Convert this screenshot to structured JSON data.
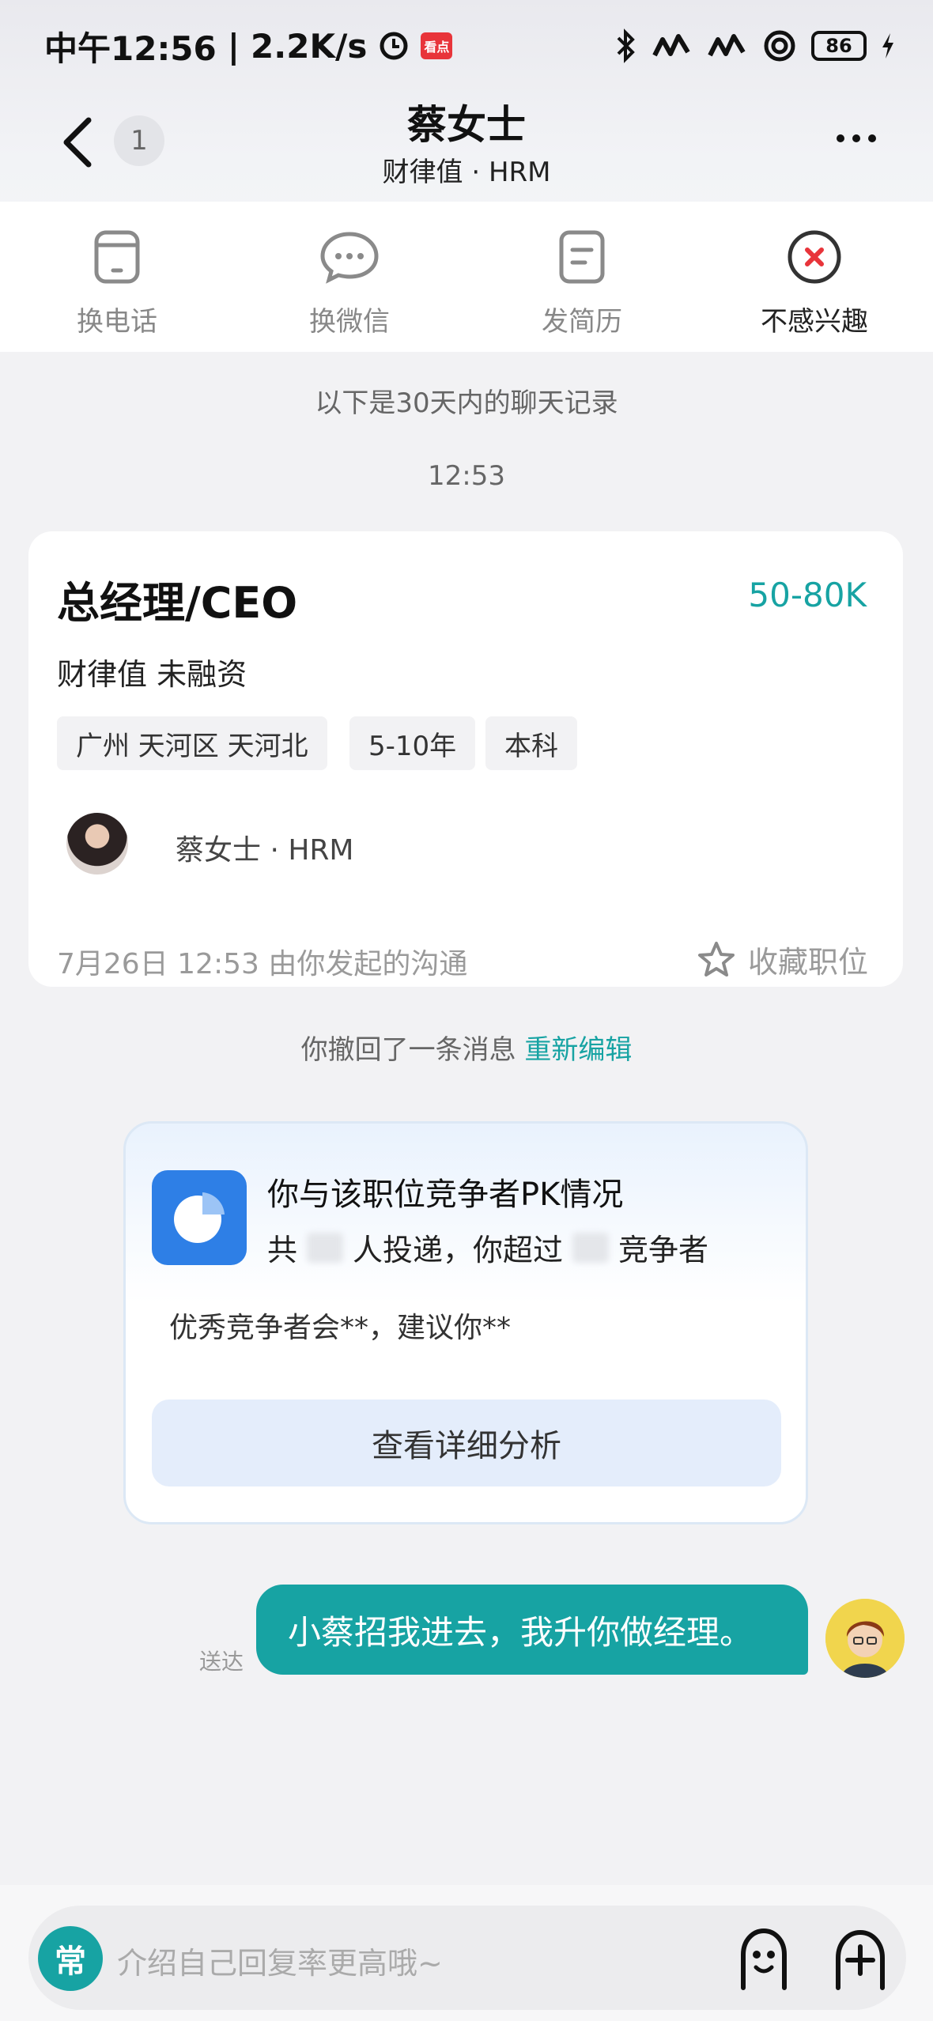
{
  "status_bar": {
    "time": "中午12:56",
    "speed": "2.2K/s",
    "battery": "86",
    "app_badge": "看点"
  },
  "header": {
    "unread_count": "1",
    "title": "蔡女士",
    "subtitle": "财律值 · HRM"
  },
  "actions": [
    {
      "label": "换电话",
      "icon": "phone-icon"
    },
    {
      "label": "换微信",
      "icon": "wechat-icon"
    },
    {
      "label": "发简历",
      "icon": "resume-icon"
    },
    {
      "label": "不感兴趣",
      "icon": "not-interested-icon"
    }
  ],
  "chat": {
    "history_notice": "以下是30天内的聊天记录",
    "time_stamp": "12:53",
    "job_card": {
      "title": "总经理/CEO",
      "salary": "50-80K",
      "company": "财律值 未融资",
      "tags": [
        "广州 天河区 天河北",
        "5-10年",
        "本科"
      ],
      "hr_name": "蔡女士 · HRM",
      "footer": "7月26日 12:53 由你发起的沟通",
      "favorite_label": "收藏职位"
    },
    "recall": {
      "text": "你撤回了一条消息",
      "action": "重新编辑"
    },
    "pk_card": {
      "title": "你与该职位竞争者PK情况",
      "line_prefix": "共",
      "line_middle": "人投递，你超过",
      "line_suffix": "竞争者",
      "description": "优秀竞争者会**，建议你**",
      "button": "查看详细分析"
    },
    "sent_message": {
      "text": "小蔡招我进去，我升你做经理。",
      "status": "送达"
    }
  },
  "input": {
    "common_label": "常",
    "placeholder": "介绍自己回复率更高哦~"
  },
  "colors": {
    "accent": "#17a3a3",
    "pk_blue": "#2e7fe6"
  }
}
